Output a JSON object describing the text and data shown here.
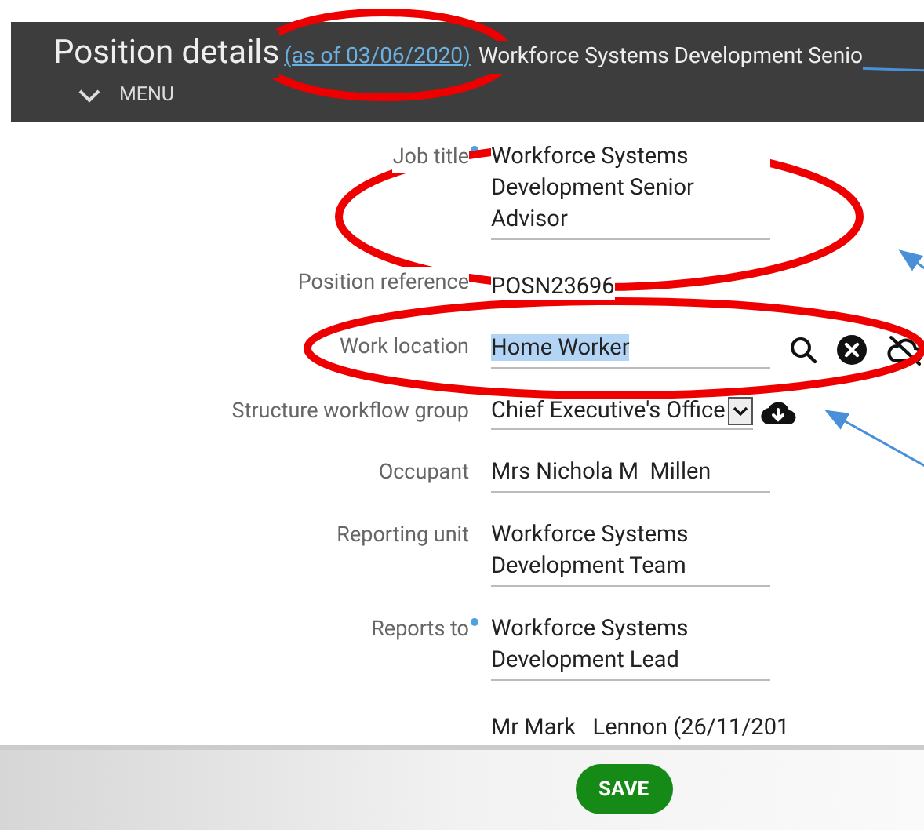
{
  "header": {
    "title": "Position details",
    "as_of_link": "(as of 03/06/2020)",
    "subtitle": "Workforce Systems Development Senio",
    "menu": "MENU"
  },
  "fields": [
    {
      "kind": "multiline",
      "label": "Job title",
      "required": true,
      "value": "Workforce Systems Development Senior Advisor"
    },
    {
      "kind": "plain",
      "label": "Position reference",
      "required": false,
      "value": "POSN23696"
    },
    {
      "kind": "lookup",
      "label": "Work location",
      "required": false,
      "value": "Home Worker",
      "highlighted": true
    },
    {
      "kind": "select",
      "label": "Structure workflow group",
      "required": false,
      "value": "Chief Executive's Office"
    },
    {
      "kind": "line",
      "label": "Occupant",
      "required": false,
      "value": "Mrs Nichola M  Millen"
    },
    {
      "kind": "multiline",
      "label": "Reporting unit",
      "required": false,
      "value": "Workforce Systems Development Team"
    },
    {
      "kind": "multiline",
      "label": "Reports to",
      "required": true,
      "value": "Workforce Systems Development Lead"
    },
    {
      "kind": "plain",
      "required": false,
      "value": "Mr Mark   Lennon (26/11/201"
    }
  ],
  "save_button": "SAVE"
}
